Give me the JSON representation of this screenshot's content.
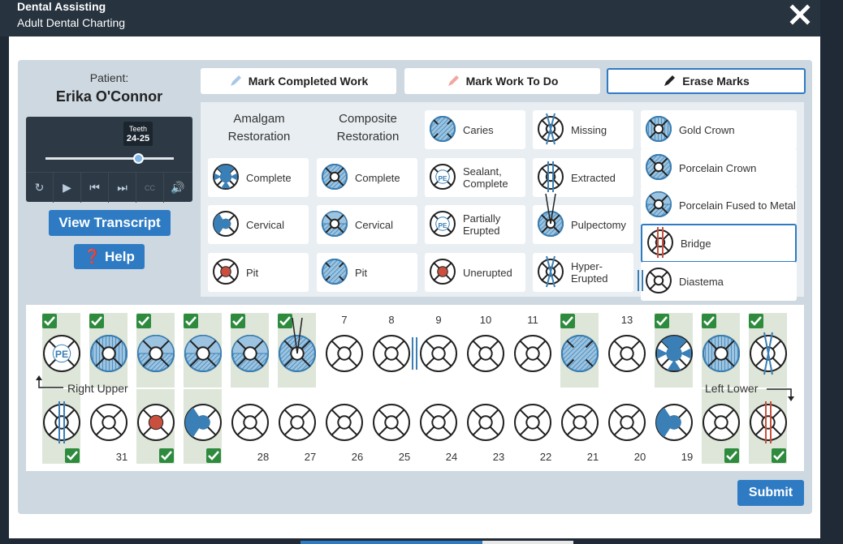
{
  "header": {
    "app_title": "Dental Assisting",
    "subtitle": "Adult Dental Charting"
  },
  "patient": {
    "label": "Patient:",
    "name": "Erika O'Connor"
  },
  "player": {
    "tooltip_title": "Teeth",
    "tooltip_value": "24-25",
    "progress_fraction": 0.72
  },
  "buttons": {
    "transcript": "View Transcript",
    "help": "Help",
    "submit": "Submit"
  },
  "modes": [
    {
      "label": "Mark Completed Work",
      "active": false
    },
    {
      "label": "Mark Work To Do",
      "active": false
    },
    {
      "label": "Erase Marks",
      "active": true
    }
  ],
  "legend": {
    "amalgam_head": "Amalgam Restoration",
    "composite_head": "Composite Restoration",
    "amalgam": [
      "Complete",
      "Cervical",
      "Pit"
    ],
    "composite": [
      "Complete",
      "Cervical",
      "Pit"
    ],
    "col3": [
      "Caries",
      "Sealant, Complete",
      "Partially Erupted",
      "Unerupted"
    ],
    "col4": [
      "Missing",
      "Extracted",
      "Pulpectomy",
      "Hyper-Erupted"
    ],
    "col5": [
      "Gold Crown",
      "Porcelain Crown",
      "Porcelain Fused to Metal",
      "Bridge",
      "Diastema"
    ],
    "selected": "Bridge"
  },
  "chart": {
    "upper_label": "Right Upper",
    "lower_label": "Left Lower",
    "upper_numbers": [
      "",
      "",
      "",
      "",
      "",
      "",
      "7",
      "8",
      "9",
      "10",
      "11",
      "",
      "13",
      "",
      "",
      ""
    ],
    "lower_numbers": [
      "",
      "31",
      "",
      "",
      "28",
      "27",
      "26",
      "25",
      "24",
      "23",
      "22",
      "21",
      "20",
      "19",
      "",
      ""
    ],
    "upper_marked": [
      true,
      true,
      true,
      true,
      true,
      true,
      false,
      false,
      false,
      false,
      false,
      true,
      false,
      true,
      true,
      true
    ],
    "lower_marked": [
      true,
      false,
      true,
      true,
      false,
      false,
      false,
      false,
      false,
      false,
      false,
      false,
      false,
      false,
      true,
      true
    ],
    "upper_marks": [
      "partially-erupted",
      "gold-crown",
      "porcelain-fused",
      "porcelain-fused",
      "porcelain-fused",
      "pulpectomy-crown",
      "",
      "",
      "diastema",
      "",
      "",
      "caries-crown",
      "",
      "amalgam-complete",
      "gold-crown",
      "missing"
    ],
    "lower_marks": [
      "extracted",
      "",
      "amalgam-pit-red",
      "amalgam-side",
      "",
      "",
      "",
      "",
      "",
      "",
      "",
      "",
      "",
      "amalgam-side",
      "",
      "bridge-red"
    ]
  },
  "colors": {
    "accent": "#2e7bc4",
    "check": "#2e8b3e",
    "marked_bg": "#dde6d8",
    "tooth_blue": "#3a7fb5",
    "red": "#c9503e"
  }
}
